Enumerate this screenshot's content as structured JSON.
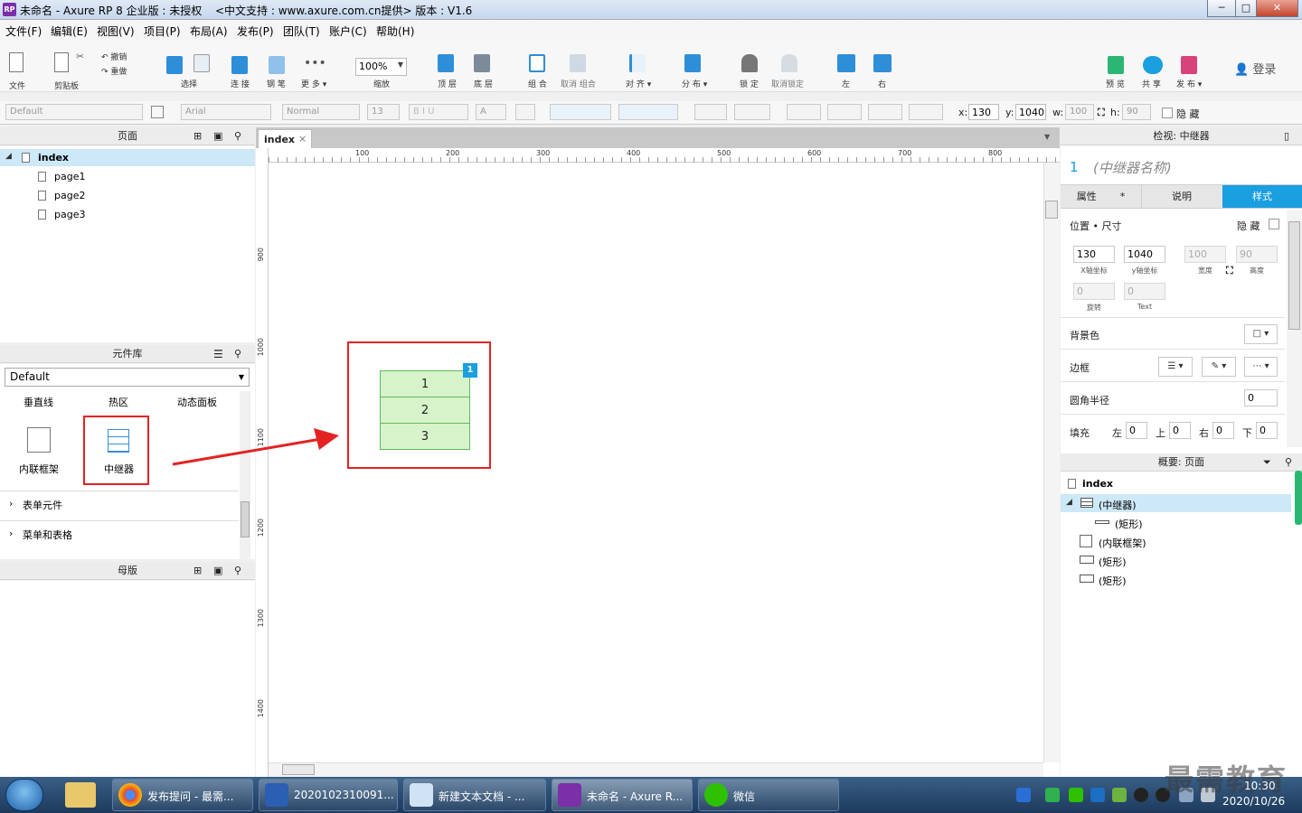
{
  "window": {
    "title": "未命名 - Axure RP 8 企业版 : 未授权",
    "subtitle": "<中文支持 : www.axure.com.cn提供> 版本 : V1.6",
    "logo": "RP",
    "min_symbol": "─",
    "max_symbol": "□",
    "close_symbol": "✕"
  },
  "menu": [
    "文件(F)",
    "编辑(E)",
    "视图(V)",
    "项目(P)",
    "布局(A)",
    "发布(P)",
    "团队(T)",
    "账户(C)",
    "帮助(H)"
  ],
  "toolbar": {
    "file": "文件",
    "clipboard": "剪贴板",
    "undo": "撤销",
    "redo": "重做",
    "select": "选择",
    "connect": "连 接",
    "pen": "钢 笔",
    "more": "更 多 ▾",
    "zoom_value": "100%",
    "zoom_label": "缩放",
    "top": "顶 层",
    "bottom": "底 层",
    "group": "组 合",
    "ungroup": "取消 组合",
    "align": "对 齐 ▾",
    "distribute": "分 布 ▾",
    "lock": "锁 定",
    "unlock": "取消锁定",
    "left": "左",
    "right": "右",
    "preview": "预 览",
    "share": "共 享",
    "publish": "发 布 ▾",
    "login": "登录"
  },
  "format_bar": {
    "style": "Default",
    "font": "Arial",
    "weight": "Normal",
    "size": "13",
    "x_label": "x:",
    "x_value": "130",
    "y_label": "y:",
    "y_value": "1040",
    "w_label": "w:",
    "w_value": "100",
    "h_label": "h:",
    "h_value": "90",
    "hide_label": "隐 藏"
  },
  "pages_panel": {
    "title": "页面",
    "root": "index",
    "pages": [
      "page1",
      "page2",
      "page3"
    ]
  },
  "library_panel": {
    "title": "元件库",
    "library": "Default",
    "top_row": [
      "垂直线",
      "热区",
      "动态面板"
    ],
    "items": [
      "内联框架",
      "中继器"
    ],
    "sections": [
      "表单元件",
      "菜单和表格"
    ]
  },
  "masters_panel": {
    "title": "母版"
  },
  "canvas": {
    "tab": "index",
    "tab_close": "×",
    "ruler_h": [
      "100",
      "200",
      "300",
      "400",
      "500",
      "600",
      "700",
      "800"
    ],
    "ruler_v": [
      "900",
      "1000",
      "1100",
      "1200",
      "1300",
      "1400"
    ],
    "repeater_rows": [
      "1",
      "2",
      "3"
    ],
    "badge": "1"
  },
  "inspector": {
    "header": "检视: 中继器",
    "index": "1",
    "name_placeholder": "(中继器名称)",
    "tabs": [
      "属性",
      "说明",
      "样式"
    ],
    "tab_mark": "*",
    "section_pos": "位置 • 尺寸",
    "hide": "隐 藏",
    "x": "130",
    "y": "1040",
    "w": "100",
    "h": "90",
    "x_label": "X轴坐标",
    "y_label": "y轴坐标",
    "w_label": "宽度",
    "h_label": "高度",
    "rotate": "0",
    "rotate_label": "旋转",
    "text_rotate": "0",
    "text_label": "Text",
    "bg_label": "背景色",
    "border_label": "边框",
    "radius_label": "圆角半径",
    "radius": "0",
    "padding_label": "填充",
    "pad_left_label": "左",
    "pad_left": "0",
    "pad_top_label": "上",
    "pad_top": "0",
    "pad_right_label": "右",
    "pad_right": "0",
    "pad_bottom_label": "下",
    "pad_bottom": "0"
  },
  "outline": {
    "title": "概要: 页面",
    "root": "index",
    "items": [
      "(中继器)",
      "(矩形)",
      "(内联框架)",
      "(矩形)",
      "(矩形)"
    ]
  },
  "taskbar": {
    "items": [
      "发布提问 - 最需...",
      "2020102310091...",
      "新建文本文档 - ...",
      "未命名 - Axure R...",
      "微信"
    ],
    "time": "10:30",
    "date": "2020/10/26",
    "watermark": "最需教育"
  },
  "colors": {
    "accent": "#1a9fe0",
    "annotation_red": "#e32323",
    "repeater_fill": "#d7f3c9",
    "repeater_border": "#5fb95f"
  }
}
